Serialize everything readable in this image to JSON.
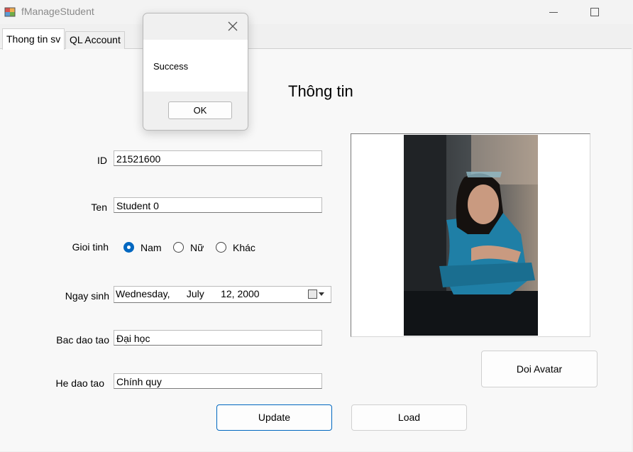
{
  "window": {
    "title": "fManageStudent"
  },
  "tabs": [
    {
      "label": "Thong tin sv",
      "selected": true
    },
    {
      "label": "QL Account",
      "selected": false
    }
  ],
  "form": {
    "heading": "Thông tin",
    "id_label": "ID",
    "id_value": "21521600",
    "ten_label": "Ten",
    "ten_value": "Student 0",
    "gioitinh_label": "Gioi tinh",
    "gender_options": [
      {
        "label": "Nam",
        "checked": true
      },
      {
        "label": "Nữ",
        "checked": false
      },
      {
        "label": "Khác",
        "checked": false
      }
    ],
    "ngaysinh_label": "Ngay sinh",
    "ngaysinh_value": "Wednesday,      July      12, 2000",
    "bacdaotao_label": "Bac dao tao",
    "bacdaotao_value": "Đại học",
    "hedaotao_label": "He dao tao",
    "hedaotao_value": "Chính quy"
  },
  "buttons": {
    "update": "Update",
    "load": "Load",
    "doi_avatar": "Doi Avatar"
  },
  "messagebox": {
    "text": "Success",
    "ok": "OK"
  },
  "colors": {
    "accent": "#0067c0"
  }
}
